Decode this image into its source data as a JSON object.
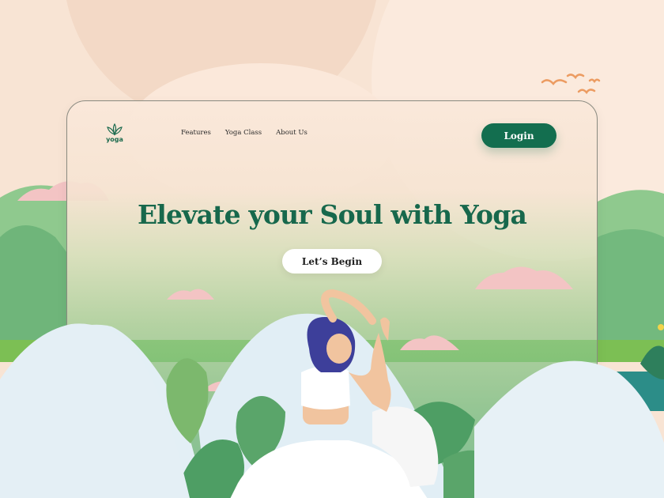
{
  "brand": {
    "name": "yoga",
    "color": "#1d6b4f"
  },
  "nav": {
    "items": [
      {
        "label": "Features"
      },
      {
        "label": "Yoga Class"
      },
      {
        "label": "About Us"
      }
    ]
  },
  "header": {
    "login_label": "Login"
  },
  "hero": {
    "headline": "Elevate your Soul with Yoga",
    "cta_label": "Let’s Begin"
  },
  "colors": {
    "accent": "#136e4f",
    "background": "#f8e4d4",
    "cloud": "#f3c4c4",
    "hill": "#7cc084",
    "mountain": "#e4eff5",
    "leaf": "#4e9e64"
  }
}
